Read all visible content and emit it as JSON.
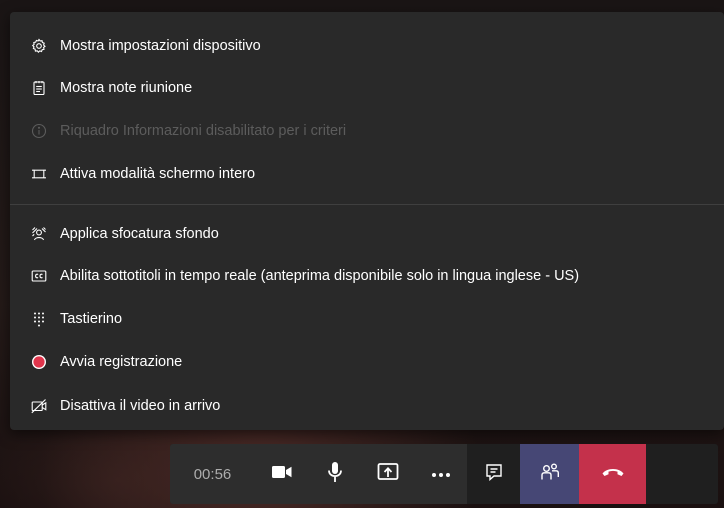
{
  "menu": {
    "items": [
      {
        "label": "Mostra impostazioni dispositivo",
        "icon": "gear-icon",
        "enabled": true
      },
      {
        "label": "Mostra note riunione",
        "icon": "notes-icon",
        "enabled": true
      },
      {
        "label": "Riquadro Informazioni disabilitato per i criteri",
        "icon": "info-icon",
        "enabled": false
      },
      {
        "label": "Attiva modalità schermo intero",
        "icon": "fullscreen-icon",
        "enabled": true
      },
      {
        "label": "Applica sfocatura sfondo",
        "icon": "blur-background-icon",
        "enabled": true
      },
      {
        "label": "Abilita sottotitoli in tempo reale (anteprima disponibile solo in lingua inglese - US)",
        "icon": "closed-captions-icon",
        "enabled": true
      },
      {
        "label": "Tastierino",
        "icon": "dialpad-icon",
        "enabled": true
      },
      {
        "label": "Avvia registrazione",
        "icon": "record-icon",
        "enabled": true
      },
      {
        "label": "Disattiva il video in arrivo",
        "icon": "video-off-icon",
        "enabled": true
      }
    ]
  },
  "toolbar": {
    "timer": "00:56",
    "buttons": [
      "camera-icon",
      "microphone-icon",
      "share-screen-icon",
      "more-options-icon",
      "chat-icon",
      "participants-icon",
      "hang-up-icon"
    ]
  },
  "colors": {
    "menu_background": "#292929",
    "toolbar_background": "#2d2d2d",
    "participants_active": "#464775",
    "hangup": "#c4314b",
    "record_dot": "#e0354c",
    "disabled_text": "#5c5c5c"
  }
}
